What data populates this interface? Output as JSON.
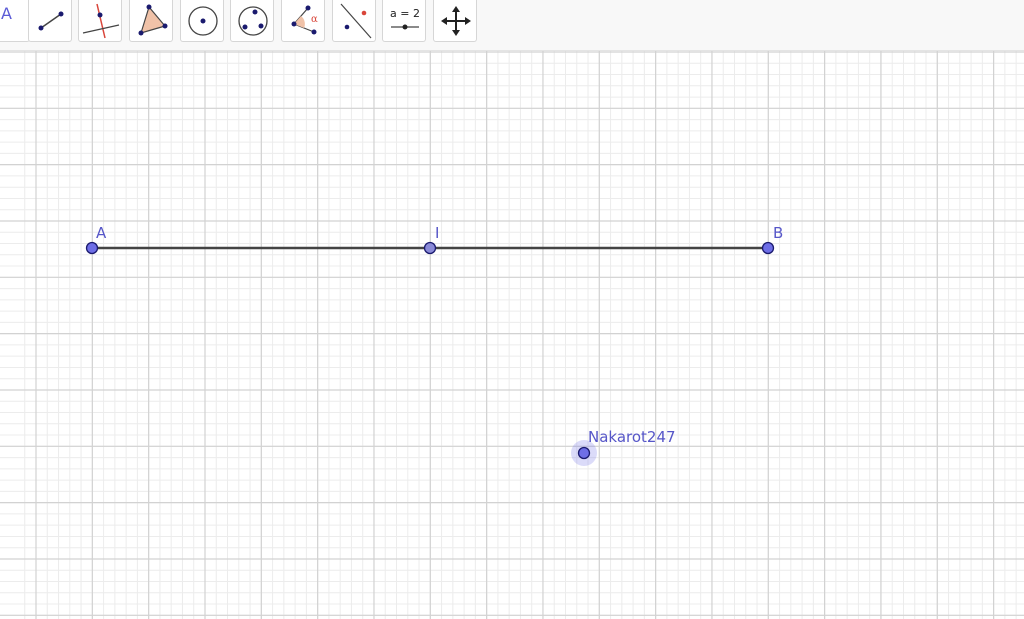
{
  "toolbar": {
    "tools": [
      {
        "id": "move",
        "label": "A"
      },
      {
        "id": "line"
      },
      {
        "id": "perpendicular"
      },
      {
        "id": "polygon"
      },
      {
        "id": "circle-center"
      },
      {
        "id": "circle-three-points"
      },
      {
        "id": "angle",
        "label": "α"
      },
      {
        "id": "reflect"
      },
      {
        "id": "slider",
        "label": "a = 2"
      },
      {
        "id": "move-graphics"
      }
    ]
  },
  "graphics": {
    "points": [
      {
        "name": "A",
        "label": "A"
      },
      {
        "name": "I",
        "label": "I"
      },
      {
        "name": "B",
        "label": "B"
      },
      {
        "name": "Nakarot247",
        "label": "Nakarot247"
      }
    ],
    "segments": [
      {
        "from": "A",
        "to": "B"
      }
    ]
  },
  "colors": {
    "point_fill": "#6e6ee6",
    "point_stroke": "#1a1a6e",
    "label": "#5656c8",
    "segment": "#444444",
    "grid_major": "#d2d2d2",
    "grid_minor": "#ececec",
    "accent": "#d9453a"
  }
}
